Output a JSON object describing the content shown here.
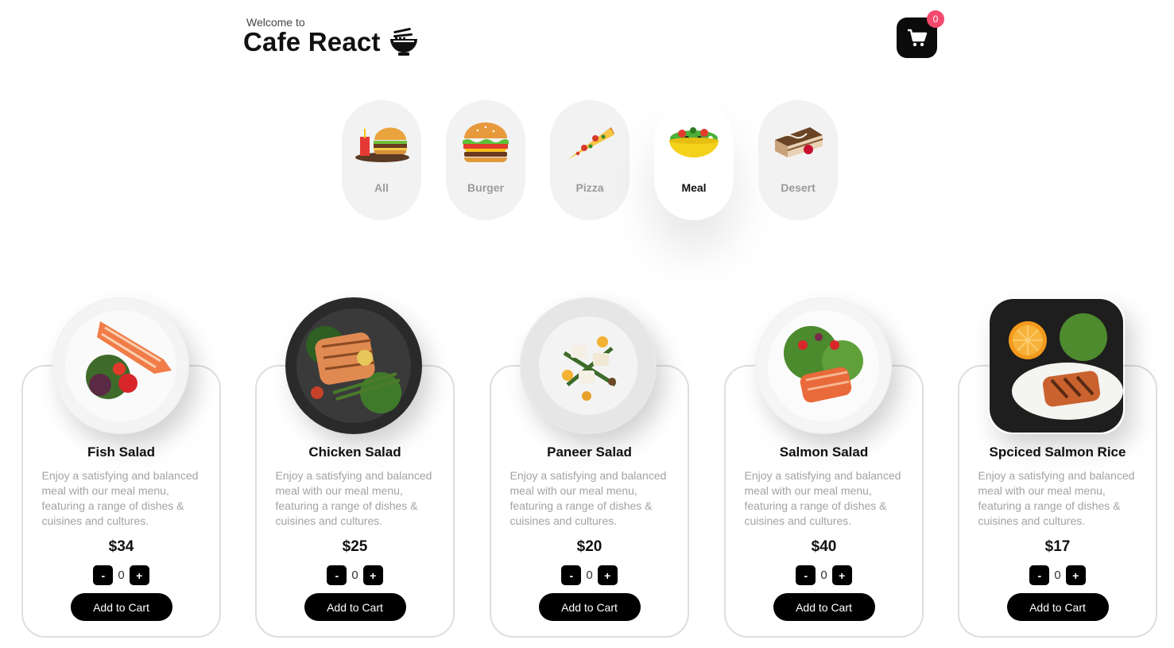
{
  "header": {
    "welcome": "Welcome to",
    "title": "Cafe React",
    "logo_icon": "ramen-bowl-icon",
    "cart_icon": "shopping-cart-icon",
    "cart_count": "0"
  },
  "categories": [
    {
      "label": "All",
      "icon": "fast-food-icon",
      "active": false
    },
    {
      "label": "Burger",
      "icon": "burger-icon",
      "active": false
    },
    {
      "label": "Pizza",
      "icon": "pizza-slice-icon",
      "active": false
    },
    {
      "label": "Meal",
      "icon": "salad-bowl-icon",
      "active": true
    },
    {
      "label": "Desert",
      "icon": "cake-slice-icon",
      "active": false
    }
  ],
  "items": [
    {
      "name": "Fish Salad",
      "description": "Enjoy a satisfying and balanced meal with our meal menu, featuring a range of dishes & cuisines and cultures.",
      "price": "$34",
      "qty": "0",
      "minus": "-",
      "plus": "+",
      "add_label": "Add to Cart",
      "image": "fish-salad-plate"
    },
    {
      "name": "Chicken Salad",
      "description": "Enjoy a satisfying and balanced meal with our meal menu, featuring a range of dishes & cuisines and cultures.",
      "price": "$25",
      "qty": "0",
      "minus": "-",
      "plus": "+",
      "add_label": "Add to Cart",
      "image": "chicken-salad-plate"
    },
    {
      "name": "Paneer Salad",
      "description": "Enjoy a satisfying and balanced meal with our meal menu, featuring a range of dishes & cuisines and cultures.",
      "price": "$20",
      "qty": "0",
      "minus": "-",
      "plus": "+",
      "add_label": "Add to Cart",
      "image": "paneer-salad-plate"
    },
    {
      "name": "Salmon Salad",
      "description": "Enjoy a satisfying and balanced meal with our meal menu, featuring a range of dishes & cuisines and cultures.",
      "price": "$40",
      "qty": "0",
      "minus": "-",
      "plus": "+",
      "add_label": "Add to Cart",
      "image": "salmon-salad-plate"
    },
    {
      "name": "Spciced Salmon Rice",
      "description": "Enjoy a satisfying and balanced meal with our meal menu, featuring a range of dishes & cuisines and cultures.",
      "price": "$17",
      "qty": "0",
      "minus": "-",
      "plus": "+",
      "add_label": "Add to Cart",
      "image": "salmon-rice-plate"
    }
  ],
  "colors": {
    "accent": "#000000",
    "badge": "#f4486d",
    "muted_text": "#a3a3a3",
    "category_bg": "#f2f2f2"
  }
}
